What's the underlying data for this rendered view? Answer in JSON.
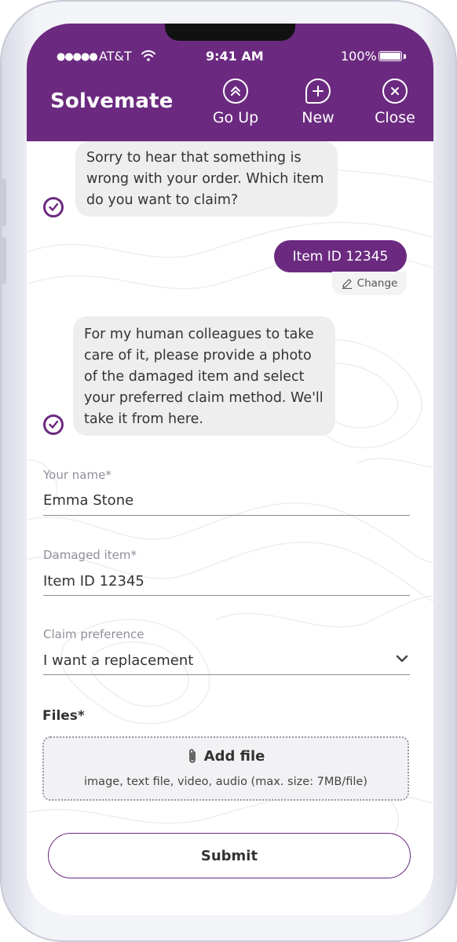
{
  "status_bar": {
    "signal": "●●●●●",
    "carrier": "AT&T",
    "time": "9:41 AM",
    "battery": "100%"
  },
  "header": {
    "brand": "Solvemate",
    "buttons": [
      {
        "label": "Go Up",
        "icon": "chevron-up-circle-icon"
      },
      {
        "label": "New",
        "icon": "plus-bubble-icon"
      },
      {
        "label": "Close",
        "icon": "close-circle-icon"
      }
    ]
  },
  "chat": {
    "bot_message_1": [
      "Sorry to hear that something is",
      "wrong with your order. Which item",
      "do you want to claim?"
    ],
    "user_message": "Item ID 12345",
    "change_label": "Change",
    "bot_message_2": [
      "For my human colleagues to take",
      "care of it, please provide a photo",
      "of the damaged item and select",
      "your preferred claim method. We'll",
      "take it from here."
    ]
  },
  "form": {
    "name": {
      "label": "Your name*",
      "value": "Emma Stone"
    },
    "item": {
      "label": "Damaged item*",
      "value": "Item ID 12345"
    },
    "claim": {
      "label": "Claim preference",
      "value": "I want a replacement"
    },
    "files": {
      "label": "Files*",
      "add_label": "Add file",
      "hint": "image, text file, video, audio (max. size: 7MB/file)"
    },
    "submit_label": "Submit"
  },
  "colors": {
    "brand": "#6b2a80",
    "bubble": "#eeeeee",
    "text": "#333333"
  }
}
